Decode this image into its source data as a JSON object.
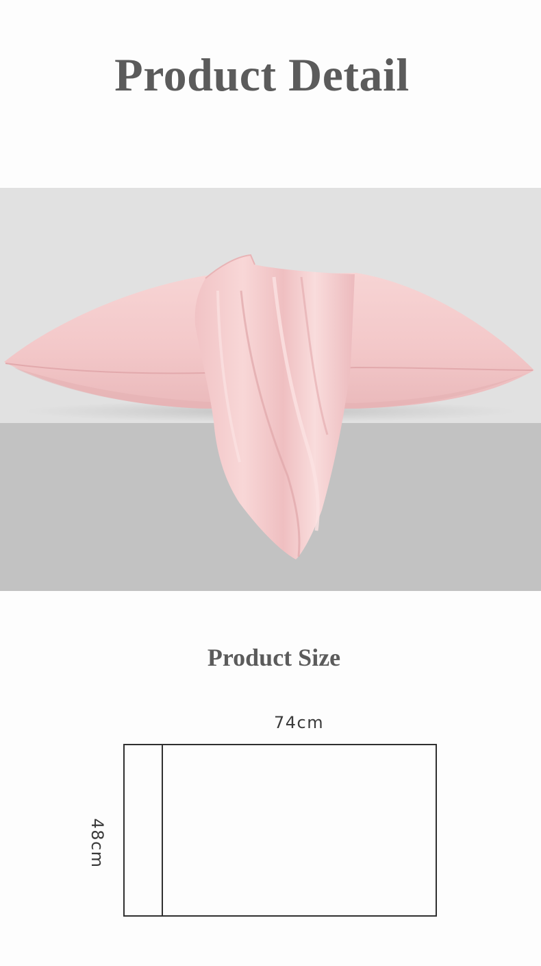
{
  "header": {
    "title": "Product Detail"
  },
  "product_photo": {
    "subject": "pink silk pillowcase",
    "colors": {
      "backdrop_top": "#e1e1e1",
      "backdrop_bottom": "#c2c2c2",
      "fabric": "#f4cbcb",
      "fabric_shadow": "#e5b0b2",
      "fabric_highlight": "#fbe2e2"
    }
  },
  "size_section": {
    "title": "Product Size",
    "width_label": "74cm",
    "height_label": "48cm"
  }
}
